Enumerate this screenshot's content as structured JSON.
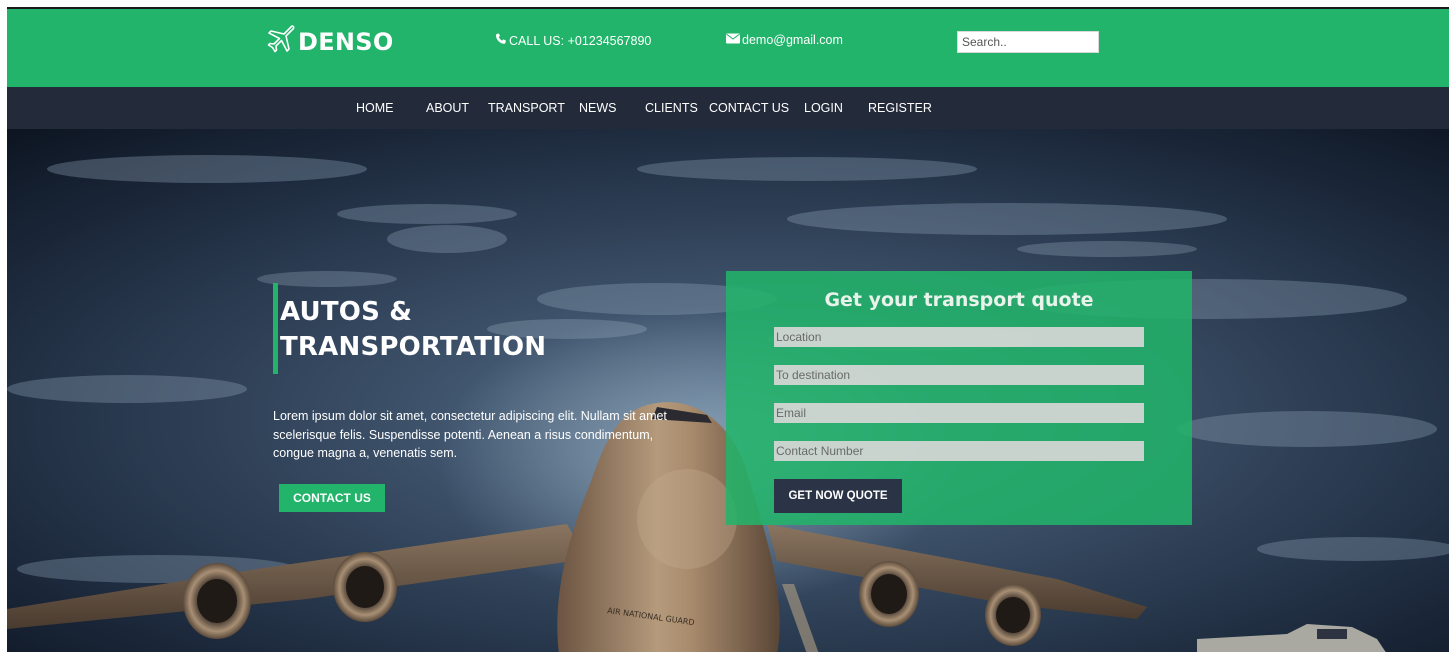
{
  "brand": {
    "name": "DENSO",
    "icon": "airplane-icon"
  },
  "header": {
    "phone": {
      "icon": "phone-icon",
      "text": "CALL US: +01234567890"
    },
    "email": {
      "icon": "envelope-icon",
      "text": "demo@gmail.com"
    },
    "search": {
      "placeholder": "Search..",
      "value": ""
    }
  },
  "nav": {
    "items": [
      {
        "label": "HOME"
      },
      {
        "label": "ABOUT"
      },
      {
        "label": "TRANSPORT"
      },
      {
        "label": "NEWS"
      },
      {
        "label": "CLIENTS"
      },
      {
        "label": "CONTACT US"
      },
      {
        "label": "LOGIN"
      },
      {
        "label": "REGISTER"
      }
    ]
  },
  "hero": {
    "title": "AUTOS & TRANSPORTATION",
    "description": "Lorem ipsum dolor sit amet, consectetur adipiscing elit. Nullam sit amet scelerisque felis. Suspendisse potenti. Aenean a risus condimentum, congue magna a, venenatis sem.",
    "button": "CONTACT US",
    "aircraft_marking": "AIR NATIONAL GUARD"
  },
  "quote_form": {
    "title": "Get your transport quote",
    "fields": [
      {
        "placeholder": "Location",
        "value": ""
      },
      {
        "placeholder": "To destination",
        "value": ""
      },
      {
        "placeholder": "Email",
        "value": ""
      },
      {
        "placeholder": "Contact Number",
        "value": ""
      }
    ],
    "submit": "GET NOW QUOTE"
  },
  "colors": {
    "primary_green": "#22b46a",
    "nav_dark": "#232a3a",
    "button_dark": "#2b3446",
    "text_white": "#ffffff"
  }
}
